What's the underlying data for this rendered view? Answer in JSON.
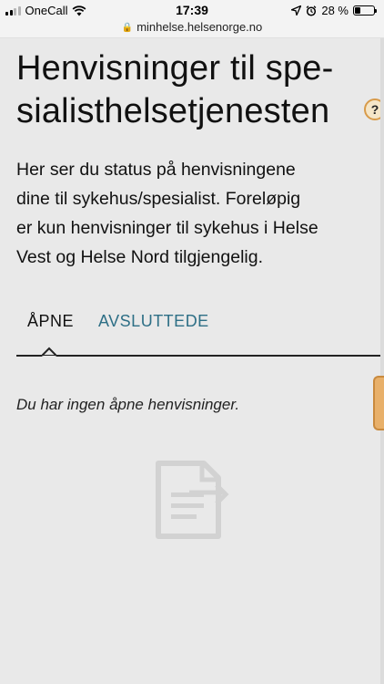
{
  "status_bar": {
    "carrier": "OneCall",
    "time": "17:39",
    "battery_text": "28 %",
    "battery_level": 0.28
  },
  "browser": {
    "url": "minhelse.helsenorge.no"
  },
  "page": {
    "title_line1": "Henvisninger til spe-",
    "title_line2": "sialisthelsetjenesten",
    "help_label": "?",
    "intro_lines": [
      "Her ser du status på henvisningene",
      "dine til sykehus/spesialist. Foreløpig",
      "er kun henvisninger til sykehus i Helse",
      "Vest og Helse Nord tilgjengelig."
    ]
  },
  "tabs": [
    {
      "label": "ÅPNE"
    },
    {
      "label": "AVSLUTTEDE"
    }
  ],
  "empty_state": {
    "message": "Du har ingen åpne henvisninger.",
    "icon": "document-arrow-icon"
  },
  "colors": {
    "background": "#e9e9e9",
    "tab_active": "#111111",
    "tab_inactive": "#2e6f86",
    "side_tab": "#e8b06a"
  }
}
